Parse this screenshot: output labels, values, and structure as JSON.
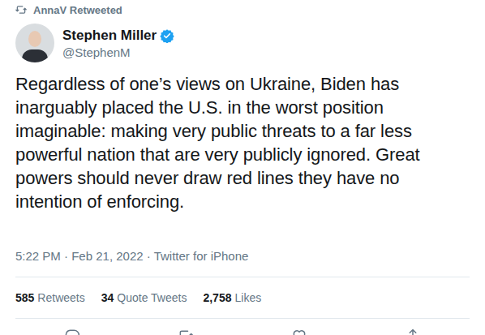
{
  "retweet_header": {
    "text": "AnnaV Retweeted"
  },
  "author": {
    "name": "Stephen Miller",
    "handle": "@StephenM",
    "verified": true
  },
  "tweet": {
    "text": "Regardless of one’s views on Ukraine, Biden has inarguably placed the U.S. in the worst position imaginable: making very public threats to a far less powerful nation that are very publicly ignored. Great powers should never draw red lines they have no intention of enforcing.",
    "timestamp": "5:22 PM · Feb 21, 2022 · Twitter for iPhone"
  },
  "stats": [
    {
      "count": "585",
      "label": "Retweets"
    },
    {
      "count": "34",
      "label": "Quote Tweets"
    },
    {
      "count": "2,758",
      "label": "Likes"
    }
  ],
  "actions": [
    {
      "kind": "reply"
    },
    {
      "kind": "retweet"
    },
    {
      "kind": "like"
    },
    {
      "kind": "share"
    }
  ]
}
